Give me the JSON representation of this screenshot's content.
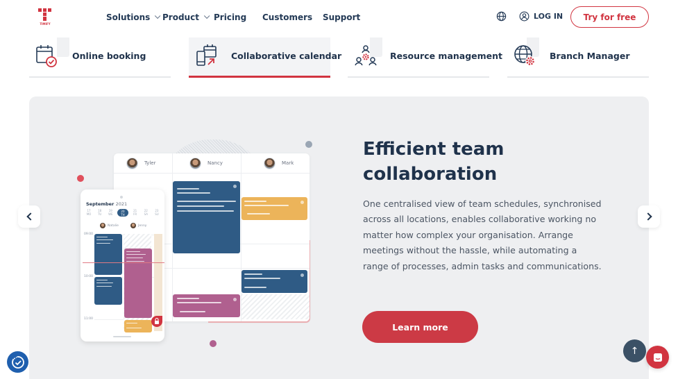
{
  "header": {
    "logo_text": "TIMIFY",
    "nav": [
      {
        "label": "Solutions",
        "has_dropdown": true
      },
      {
        "label": "Product",
        "has_dropdown": true
      },
      {
        "label": "Pricing",
        "has_dropdown": false
      },
      {
        "label": "Customers",
        "has_dropdown": false
      },
      {
        "label": "Support",
        "has_dropdown": false
      }
    ],
    "language_icon": "globe-icon",
    "login_label": "LOG IN",
    "cta_label": "Try for free"
  },
  "feature_tabs": [
    {
      "label": "Online booking",
      "icon": "calendar-check-icon",
      "active": false
    },
    {
      "label": "Collaborative calendar",
      "icon": "devices-calendar-icon",
      "active": true
    },
    {
      "label": "Resource management",
      "icon": "team-gear-icon",
      "active": false
    },
    {
      "label": "Branch Manager",
      "icon": "globe-gear-icon",
      "active": false
    }
  ],
  "hero": {
    "title": "Efficient team collaboration",
    "description": "One centralised view of team schedules, synchronised across all locations, enables collaborative working no matter how complex your organisation. Arrange meetings without the hassle, while automating a range of processes, admin tasks and communications.",
    "cta_label": "Learn more",
    "prev_label": "previous-slide",
    "next_label": "next-slide"
  },
  "illustration": {
    "board_staff": [
      "Tyler",
      "Nancy",
      "Mark"
    ],
    "phone_month": "September",
    "phone_year": "2021",
    "phone_days": [
      {
        "num": "17",
        "dow": "MO"
      },
      {
        "num": "18",
        "dow": "TU"
      },
      {
        "num": "19",
        "dow": "WE"
      },
      {
        "num": "20",
        "dow": "TH",
        "selected": true
      },
      {
        "num": "21",
        "dow": "FR"
      },
      {
        "num": "22",
        "dow": "SA"
      },
      {
        "num": "23",
        "dow": "SU"
      }
    ],
    "phone_staff": [
      "Natalie",
      "Jenny"
    ],
    "phone_times": [
      "09:00",
      "10:00",
      "11:00"
    ]
  },
  "colors": {
    "brand_red": "#d13440",
    "navy": "#1f324b",
    "event_blue": "#2f5b85",
    "event_orange": "#ecb45a",
    "event_pink": "#b0608f",
    "hero_bg": "#eeeff1"
  },
  "widgets": {
    "scroll_top_symbol": "↑",
    "chat_icon": "chat-icon",
    "accessibility_icon": "accessibility-icon"
  }
}
